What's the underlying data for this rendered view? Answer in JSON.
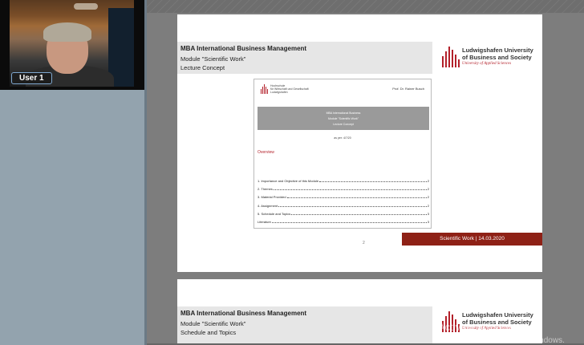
{
  "participant": {
    "name": "User 1"
  },
  "slide1": {
    "title": "MBA International Business Management",
    "module": "Module \"Scientific Work\"",
    "subtitle": "Lecture Concept",
    "logo": {
      "line1": "Ludwigshafen University",
      "line2": "of Business and Society",
      "tagline": "University of Applied Sciences"
    },
    "inner_doc": {
      "school_line1": "Hochschule",
      "school_line2": "für Wirtschaft und Gesellschaft",
      "school_line3": "Ludwigshafen",
      "author": "Prof. Dr. Rainer Busch",
      "grey_line1": "MBA International Business",
      "grey_line2": "Module \"Scientific Work\"",
      "grey_line3": "Lecture Concept",
      "as_per": "as per: 4/7/20",
      "overview": "Overview",
      "toc": [
        {
          "label": "1. Importance and Objective of this Module",
          "page": "2"
        },
        {
          "label": "2. Themes",
          "page": "2"
        },
        {
          "label": "3. Material Provided",
          "page": "2"
        },
        {
          "label": "4. Assignment",
          "page": "2"
        },
        {
          "label": "5. Schedule and Topics",
          "page": "3"
        },
        {
          "label": "Literature",
          "page": "3"
        }
      ]
    },
    "page_number": "2",
    "footer": "Scientific Work | 14.03.2020"
  },
  "slide2": {
    "title": "MBA International Business Management",
    "module": "Module \"Scientific Work\"",
    "subtitle": "Schedule and Topics",
    "logo": {
      "line1": "Ludwigshafen University",
      "line2": "of Business and Society",
      "tagline": "University of Applied Sciences"
    }
  },
  "watermark": {
    "line1": "Activate Windows",
    "line2": "Go to Settings to activate Windows."
  },
  "colors": {
    "brand_red": "#b3202a",
    "footer_red": "#8e2116"
  }
}
